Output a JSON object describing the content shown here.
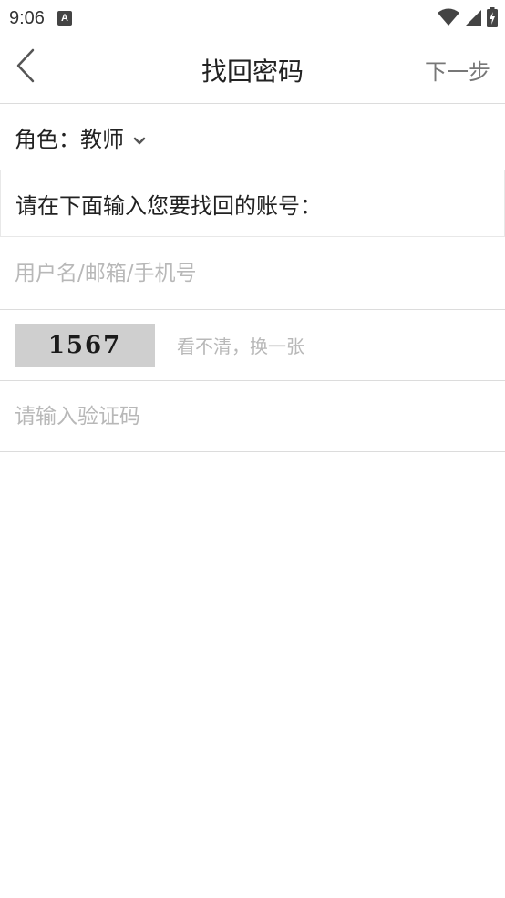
{
  "status_bar": {
    "time": "9:06",
    "app_icon_letter": "A",
    "icons": [
      "wifi-icon",
      "signal-icon",
      "battery-icon"
    ]
  },
  "header": {
    "title": "找回密码",
    "next_label": "下一步",
    "back_icon": "chevron-left-icon"
  },
  "role": {
    "label": "角色：",
    "value": "教师",
    "dropdown_icon": "chevron-down-icon"
  },
  "prompt": {
    "text": "请在下面输入您要找回的账号："
  },
  "account": {
    "value": "",
    "placeholder": "用户名/邮箱/手机号"
  },
  "captcha": {
    "code": "1567",
    "refresh_label": "看不清，换一张"
  },
  "verification": {
    "value": "",
    "placeholder": "请输入验证码"
  },
  "colors": {
    "background": "#ffffff",
    "divider": "#dcdcdc",
    "placeholder": "#b8b8b8",
    "captcha_bg": "#cfcfcf"
  }
}
